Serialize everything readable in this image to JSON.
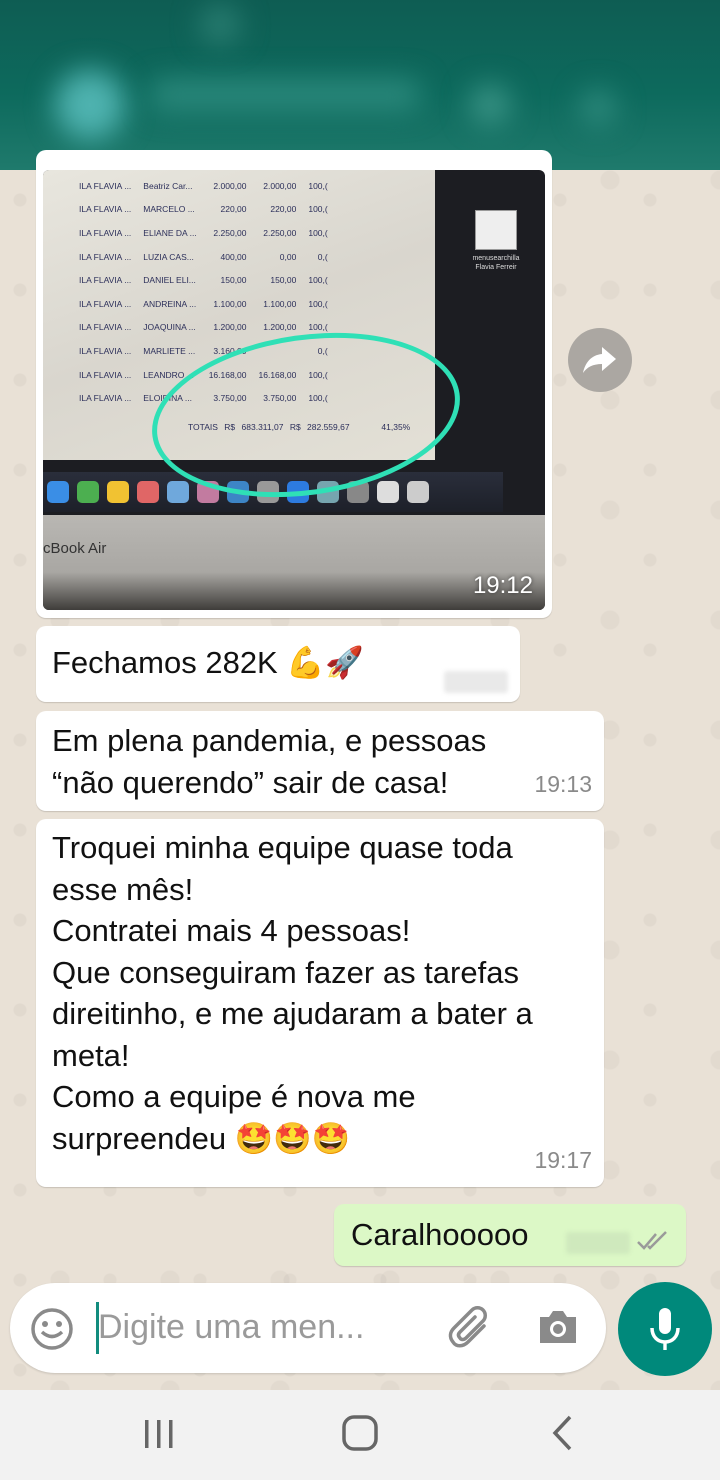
{
  "image_message": {
    "spreadsheet_rows": [
      [
        "ILA FLAVIA ...",
        "Beatriz Car...",
        "2.000,00",
        "2.000,00",
        "100,("
      ],
      [
        "ILA FLAVIA ...",
        "MARCELO ...",
        "220,00",
        "220,00",
        "100,("
      ],
      [
        "ILA FLAVIA ...",
        "ELIANE DA ...",
        "2.250,00",
        "2.250,00",
        "100,("
      ],
      [
        "ILA FLAVIA ...",
        "LUZIA CAS...",
        "400,00",
        "0,00",
        "0,("
      ],
      [
        "ILA FLAVIA ...",
        "DANIEL ELI...",
        "150,00",
        "150,00",
        "100,("
      ],
      [
        "ILA FLAVIA ...",
        "ANDREINA ...",
        "1.100,00",
        "1.100,00",
        "100,("
      ],
      [
        "ILA FLAVIA ...",
        "JOAQUINA ...",
        "1.200,00",
        "1.200,00",
        "100,("
      ],
      [
        "ILA FLAVIA ...",
        "MARLIETE ...",
        "3.160,00",
        "",
        "0,("
      ],
      [
        "ILA FLAVIA ...",
        "LEANDRO ...",
        "16.168,00",
        "16.168,00",
        "100,("
      ],
      [
        "ILA FLAVIA ...",
        "ELOIDINA ...",
        "3.750,00",
        "3.750,00",
        "100,("
      ]
    ],
    "totals_label": "TOTAIS",
    "totals_value_1": "R$ 683.311,07",
    "totals_value_2": "R$ 282.559,67",
    "totals_percent": "41,35%",
    "desktop_icon_label": "menusearchilla Flavia Ferreir",
    "laptop_brand": "cBook Air",
    "time": "19:12"
  },
  "messages": [
    {
      "text": "Fechamos 282K 💪🚀",
      "time": ""
    },
    {
      "text_lines": [
        "Em plena pandemia, e pessoas",
        "“não querendo” sair de casa!"
      ],
      "time": "19:13"
    },
    {
      "text_lines": [
        "Troquei minha equipe quase toda",
        "esse mês!",
        "Contratei mais 4 pessoas!",
        "Que conseguiram fazer as tarefas",
        "direitinho, e me ajudaram a bater a",
        "meta!",
        "Como a equipe é nova me",
        "surpreendeu 🤩🤩🤩"
      ],
      "time": "19:17"
    },
    {
      "text": "Caralhooooo",
      "status": "read-double-check"
    }
  ],
  "input": {
    "placeholder": "Digite uma men..."
  },
  "icons": {
    "forward": "forward-icon",
    "emoji": "emoji-icon",
    "attach": "paperclip-icon",
    "camera": "camera-icon",
    "mic": "mic-icon",
    "nav_recents": "recents-icon",
    "nav_home": "home-icon",
    "nav_back": "back-icon"
  },
  "colors": {
    "accent": "#00897B",
    "outgoing_bubble": "#DCF8C6",
    "annotation": "#2fe0b6"
  }
}
